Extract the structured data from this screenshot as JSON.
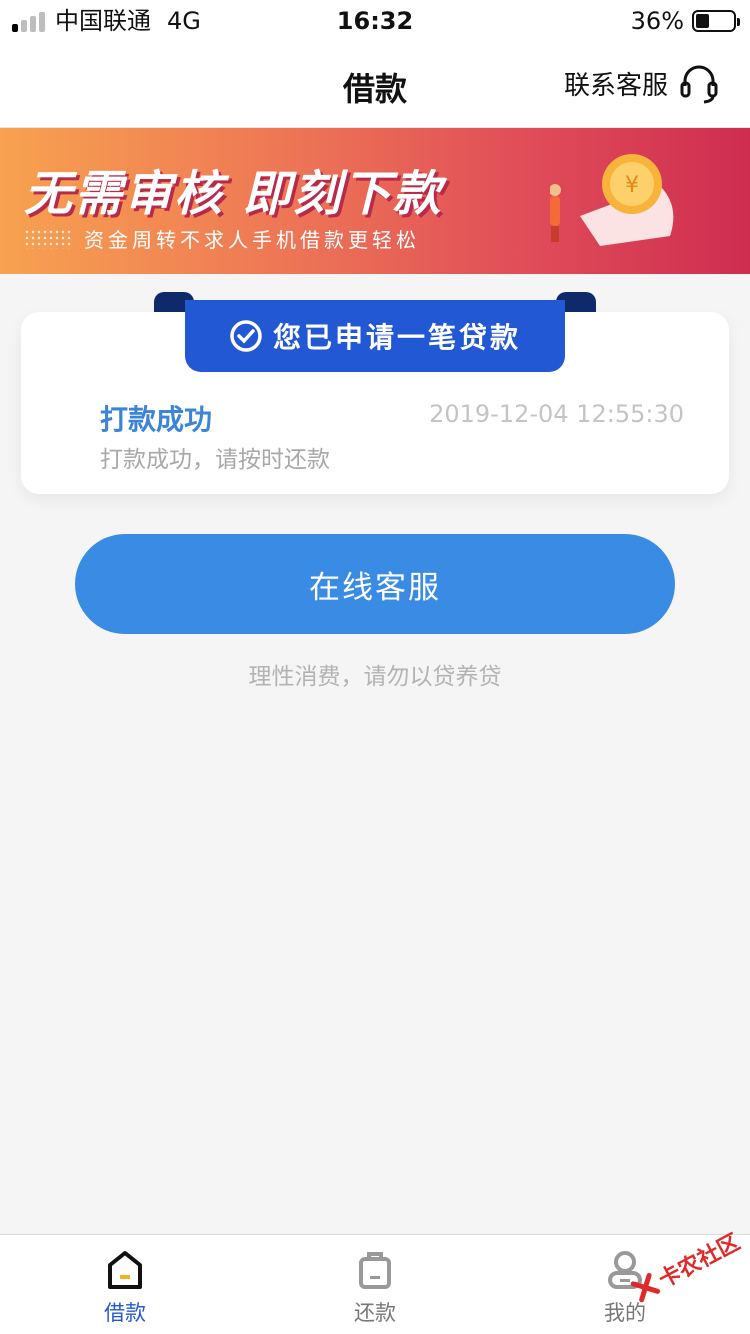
{
  "status_bar": {
    "carrier": "中国联通",
    "network": "4G",
    "time": "16:32",
    "battery_percent": "36%",
    "battery_level": 0.36
  },
  "nav": {
    "title": "借款",
    "service_label": "联系客服",
    "service_icon": "headset-icon"
  },
  "banner": {
    "headline": "无需审核  即刻下款",
    "subline": "资金周转不求人手机借款更轻松"
  },
  "card": {
    "ribbon_text": "您已申请一笔贷款",
    "ribbon_icon": "check-circle-icon",
    "status_title": "打款成功",
    "status_time": "2019-12-04 12:55:30",
    "status_desc": "打款成功，请按时还款"
  },
  "main": {
    "button_label": "在线客服",
    "tip": "理性消费，请勿以贷养贷"
  },
  "tabs": [
    {
      "label": "借款",
      "icon": "borrow-icon",
      "active": true
    },
    {
      "label": "还款",
      "icon": "repay-icon",
      "active": false
    },
    {
      "label": "我的",
      "icon": "profile-icon",
      "active": false
    }
  ],
  "watermark": {
    "text": "卡农社区"
  },
  "colors": {
    "accent": "#2358d4",
    "button": "#3a8be4",
    "status_title": "#3b84d6"
  }
}
